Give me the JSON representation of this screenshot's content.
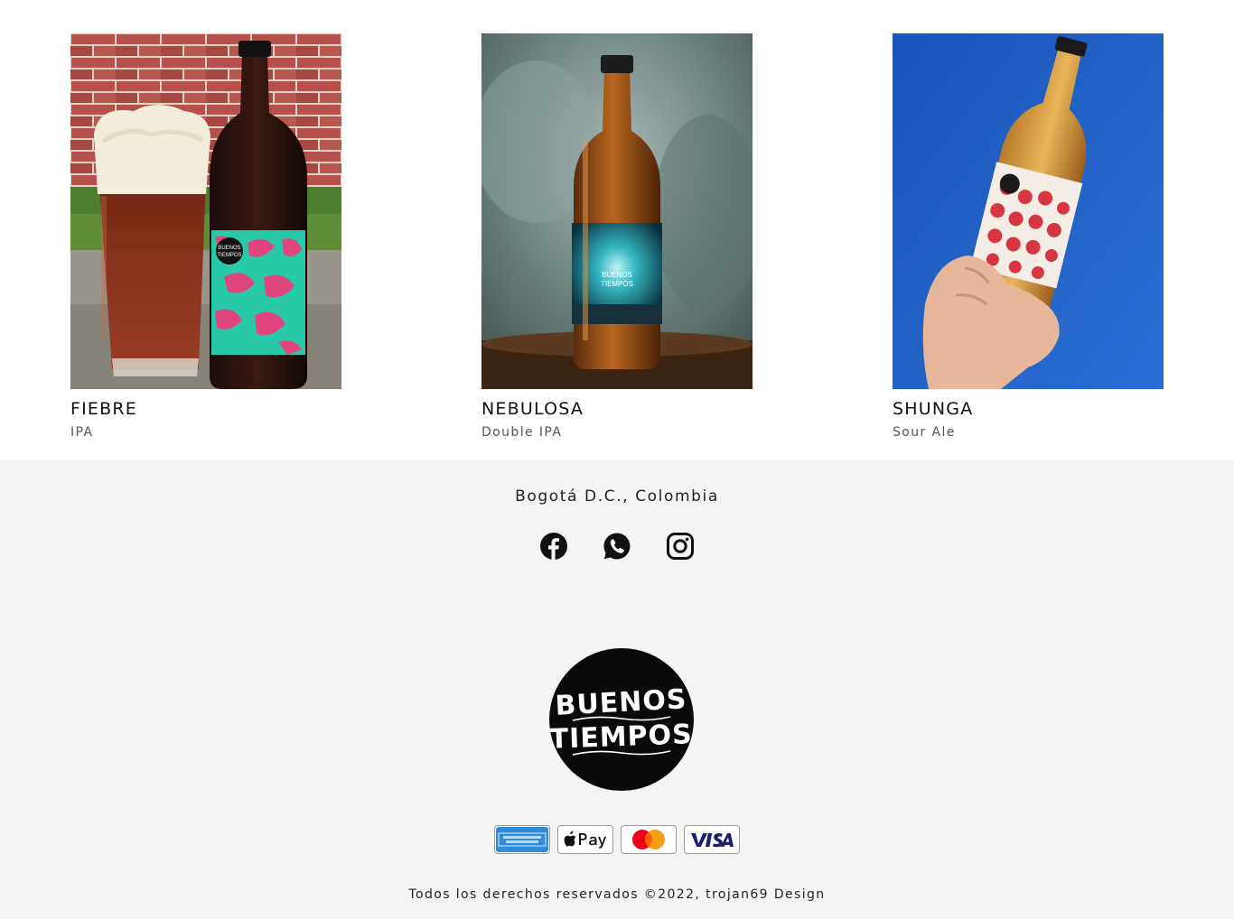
{
  "products": [
    {
      "name": "FIEBRE",
      "style": "IPA",
      "image_alt": "Fiebre IPA bottle beside a full glass"
    },
    {
      "name": "NEBULOSA",
      "style": "Double IPA",
      "image_alt": "Nebulosa Double IPA bottle"
    },
    {
      "name": "SHUNGA",
      "style": "Sour Ale",
      "image_alt": "Shunga Sour Ale bottle held against the sky"
    }
  ],
  "footer": {
    "location": "Bogotá D.C., Colombia",
    "social": [
      {
        "icon": "facebook-icon"
      },
      {
        "icon": "whatsapp-icon"
      },
      {
        "icon": "instagram-icon"
      }
    ],
    "brand_logo": {
      "line1": "BUENOS",
      "line2": "TIEMPOS"
    },
    "payments": [
      {
        "icon": "american-express-icon"
      },
      {
        "icon": "apple-pay-icon"
      },
      {
        "icon": "mastercard-icon"
      },
      {
        "icon": "visa-icon"
      }
    ],
    "copyright": "Todos los derechos reservados ©2022, trojan69 Design"
  },
  "colors": {
    "footer_background": "#f4f4f4",
    "text": "#111111",
    "sky_blue": "#1d5fc4",
    "label_teal": "#27c9a6",
    "label_pink": "#e0457e"
  }
}
